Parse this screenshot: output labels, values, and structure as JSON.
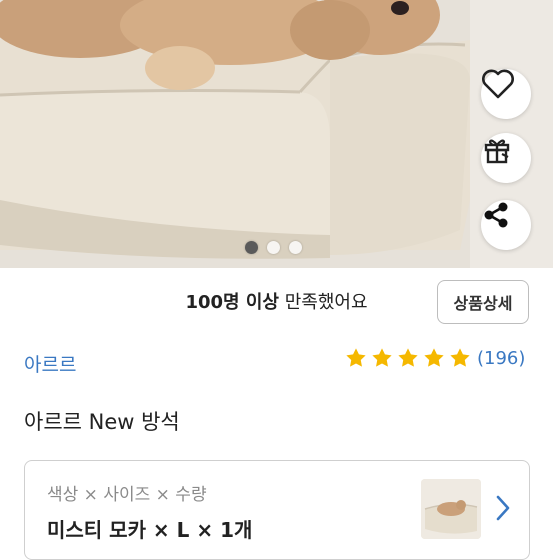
{
  "hero": {
    "image": "beige dog bed with a curly puppy lying on it",
    "actions": [
      {
        "icon": "heart-icon"
      },
      {
        "icon": "gift-icon"
      },
      {
        "icon": "share-icon"
      }
    ],
    "carousel": {
      "total": 3,
      "current": 1
    }
  },
  "satisfaction": {
    "strong": "100명 이상",
    "rest": " 만족했어요",
    "detail_button": "상품상세"
  },
  "product": {
    "brand": "아르르",
    "rating_stars": 5,
    "review_count": "(196)",
    "name": "아르르 New 방석"
  },
  "option": {
    "label": "색상 × 사이즈 × 수량",
    "value": "미스티 모카 × L × 1개",
    "icon": "chevron-right-icon"
  },
  "colors": {
    "accent_blue": "#3a78c2",
    "star_yellow": "#f5b800"
  }
}
